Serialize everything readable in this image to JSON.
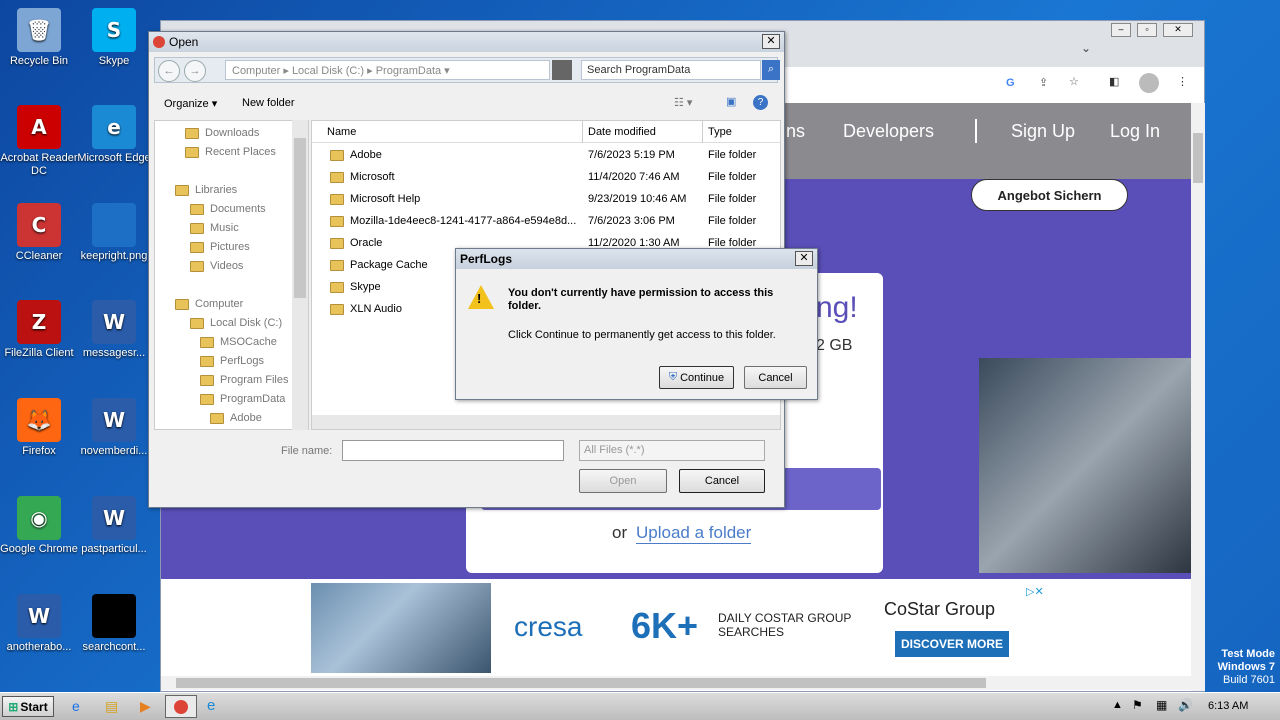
{
  "desktop_icons": [
    {
      "label": "Recycle Bin",
      "icon": "recycle-bin-icon",
      "glyph": "🗑"
    },
    {
      "label": "Skype",
      "icon": "skype-icon",
      "glyph": "S"
    },
    {
      "label": "Acrobat Reader DC",
      "icon": "acrobat-icon",
      "glyph": "A"
    },
    {
      "label": "Microsoft Edge",
      "icon": "edge-icon",
      "glyph": "e"
    },
    {
      "label": "CCleaner",
      "icon": "ccleaner-icon",
      "glyph": "C"
    },
    {
      "label": "keepright.png",
      "icon": "image-file-icon",
      "glyph": ""
    },
    {
      "label": "FileZilla Client",
      "icon": "filezilla-icon",
      "glyph": "Z"
    },
    {
      "label": "messagesr...",
      "icon": "word-doc-icon",
      "glyph": "W"
    },
    {
      "label": "Firefox",
      "icon": "firefox-icon",
      "glyph": "🦊"
    },
    {
      "label": "novemberdi...",
      "icon": "word-doc-icon",
      "glyph": "W"
    },
    {
      "label": "Google Chrome",
      "icon": "chrome-icon",
      "glyph": "◉"
    },
    {
      "label": "pastparticul...",
      "icon": "word-doc-icon",
      "glyph": "W"
    },
    {
      "label": "anotherabo...",
      "icon": "word-doc-icon",
      "glyph": "W"
    },
    {
      "label": "searchcont...",
      "icon": "black-file-icon",
      "glyph": ""
    }
  ],
  "browser": {
    "nav_links": [
      "ns",
      "Developers",
      "Sign Up",
      "Log In"
    ],
    "angebot_label": "Angebot Sichern",
    "headline_fragment": "ng!",
    "size_fragment": "2 GB",
    "or_label": "or",
    "upload_folder": "Upload a folder",
    "ad": {
      "brand": "cresa",
      "big": "6K+",
      "sub": "DAILY COSTAR GROUP SEARCHES",
      "costar": "CoStar Group",
      "cta": "DISCOVER MORE"
    }
  },
  "open_dialog": {
    "title": "Open",
    "breadcrumb": [
      "Computer",
      "Local Disk (C:)",
      "ProgramData"
    ],
    "search_placeholder": "Search ProgramData",
    "organize": "Organize",
    "new_folder": "New folder",
    "tree": [
      {
        "label": "Downloads"
      },
      {
        "label": "Recent Places"
      },
      {
        "label": "Libraries"
      },
      {
        "label": "Documents"
      },
      {
        "label": "Music"
      },
      {
        "label": "Pictures"
      },
      {
        "label": "Videos"
      },
      {
        "label": "Computer"
      },
      {
        "label": "Local Disk (C:)"
      },
      {
        "label": "MSOCache"
      },
      {
        "label": "PerfLogs"
      },
      {
        "label": "Program Files"
      },
      {
        "label": "ProgramData"
      },
      {
        "label": "Adobe"
      }
    ],
    "columns": [
      "Name",
      "Date modified",
      "Type"
    ],
    "files": [
      {
        "name": "Adobe",
        "date": "7/6/2023 5:19 PM",
        "type": "File folder"
      },
      {
        "name": "Microsoft",
        "date": "11/4/2020 7:46 AM",
        "type": "File folder"
      },
      {
        "name": "Microsoft Help",
        "date": "9/23/2019 10:46 AM",
        "type": "File folder"
      },
      {
        "name": "Mozilla-1de4eec8-1241-4177-a864-e594e8d...",
        "date": "7/6/2023 3:06 PM",
        "type": "File folder"
      },
      {
        "name": "Oracle",
        "date": "11/2/2020 1:30 AM",
        "type": "File folder"
      },
      {
        "name": "Package Cache",
        "date": "",
        "type": ""
      },
      {
        "name": "Skype",
        "date": "",
        "type": ""
      },
      {
        "name": "XLN Audio",
        "date": "",
        "type": ""
      }
    ],
    "file_name_label": "File name:",
    "file_name_value": "",
    "filter": "All Files (*.*)",
    "open_btn": "Open",
    "cancel_btn": "Cancel"
  },
  "perm_dialog": {
    "title": "PerfLogs",
    "message": "You don't currently have permission to access this folder.",
    "sub": "Click Continue to permanently get access to this folder.",
    "continue_btn": "Continue",
    "cancel_btn": "Cancel"
  },
  "watermark": {
    "line1": "Test Mode",
    "line2": "Windows 7",
    "line3": "Build 7601"
  },
  "taskbar": {
    "start": "Start",
    "clock": "6:13 AM"
  }
}
